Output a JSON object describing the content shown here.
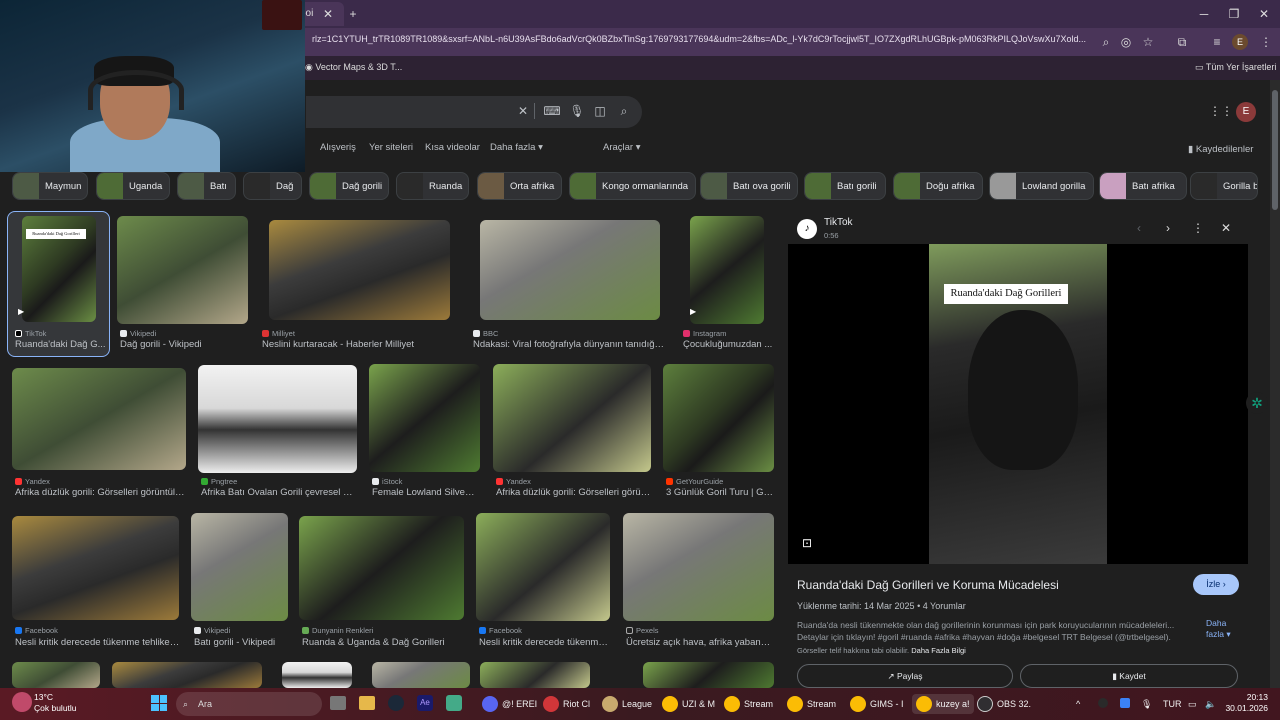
{
  "browser": {
    "tab_label": "ooi",
    "url": "rlz=1C1YTUH_trTR1089TR1089&sxsrf=ANbL-n6U39AsFBdo6adVcrQk0BZbxTinSg:1769793177694&udm=2&fbs=ADc_l-Yk7dC9rTocjjwl5T_IO7ZXgdRLhUGBpk-pM063RkPILQJoVswXu7Xold...",
    "bookmark_1": "Vector Maps & 3D T...",
    "bookmark_all": "Tüm Yer İşaretleri",
    "profile_letter": "E"
  },
  "google": {
    "profile_letter": "E",
    "nav": [
      "Alışveriş",
      "Yer siteleri",
      "Kısa videolar",
      "Daha fazla",
      "Araçlar"
    ],
    "saved": "Kaydedilenler",
    "chips": [
      "Maymun",
      "Uganda",
      "Batı",
      "Dağ",
      "Dağ gorili",
      "Ruanda",
      "Orta afrika",
      "Kongo ormanlarında",
      "Batı ova gorili",
      "Batı gorili",
      "Doğu afrika",
      "Lowland gorilla",
      "Batı afrika",
      "Gorilla b"
    ]
  },
  "results": {
    "row1": [
      {
        "source": "TikTok",
        "caption": "Ruanda'daki Dağ G..."
      },
      {
        "source": "Vikipedi",
        "caption": "Dağ gorili - Vikipedi"
      },
      {
        "source": "Milliyet",
        "caption": "Neslini kurtaracak - Haberler Milliyet"
      },
      {
        "source": "BBC",
        "caption": "Ndakasi: Viral fotoğrafıyla dünyanın tanıdığı go..."
      },
      {
        "source": "Instagram",
        "caption": "Çocukluğumuzdan ..."
      }
    ],
    "row2": [
      {
        "source": "Yandex",
        "caption": "Afrika düzlük gorili: Görselleri görüntüley..."
      },
      {
        "source": "Pngtree",
        "caption": "Afrika Batı Ovalan Gorili çevresel Ha..."
      },
      {
        "source": "iStock",
        "caption": "Female Lowland Silverb..."
      },
      {
        "source": "Yandex",
        "caption": "Afrika düzlük gorili: Görselleri görünt..."
      },
      {
        "source": "GetYourGuide",
        "caption": "3 Günlük Goril Turu | Ge..."
      }
    ],
    "row3": [
      {
        "source": "Facebook",
        "caption": "Nesli kritik derecede tükenme tehlikes..."
      },
      {
        "source": "Vikipedi",
        "caption": "Batı gorili - Vikipedi"
      },
      {
        "source": "Dunyanin Renkleri",
        "caption": "Ruanda & Uganda & Dağ Gorilleri"
      },
      {
        "source": "Facebook",
        "caption": "Nesli kritik derecede tükenme ..."
      },
      {
        "source": "Pexels",
        "caption": "Ücretsiz açık hava, afrika yaban h..."
      }
    ]
  },
  "panel": {
    "source": "TikTok",
    "duration": "0:56",
    "video_overlay": "Ruanda'daki Dağ Gorilleri",
    "title": "Ruanda'daki Dağ Gorilleri ve Koruma Mücadelesi",
    "watch": "İzle",
    "upload_date": "Yüklenme tarihi: 14 Mar 2025",
    "comments": "4 Yorumlar",
    "description": "Ruanda'da nesli tükenmekte olan dağ gorillerinin korunması için park koruyucularının mücadeleleri... Detaylar için tıklayın! #goril #ruanda #afrika #hayvan #doğa #belgesel TRT Belgesel (@trtbelgesel).",
    "more": "Daha fazla",
    "copyright": "Görseller telif hakkına tabi olabilir.",
    "learn_more": "Daha Fazla Bilgi",
    "share": "Paylaş",
    "save": "Kaydet"
  },
  "taskbar": {
    "weather_temp": "13°C",
    "weather_desc": "Çok bulutlu",
    "search": "Ara",
    "apps": [
      "@! EREI",
      "Riot Cl",
      "League",
      "UZI & M",
      "Stream",
      "Stream",
      "GIMS - I",
      "kuzey a!",
      "OBS 32."
    ],
    "lang": "TUR",
    "time": "20:13",
    "date": "30.01.2026"
  }
}
